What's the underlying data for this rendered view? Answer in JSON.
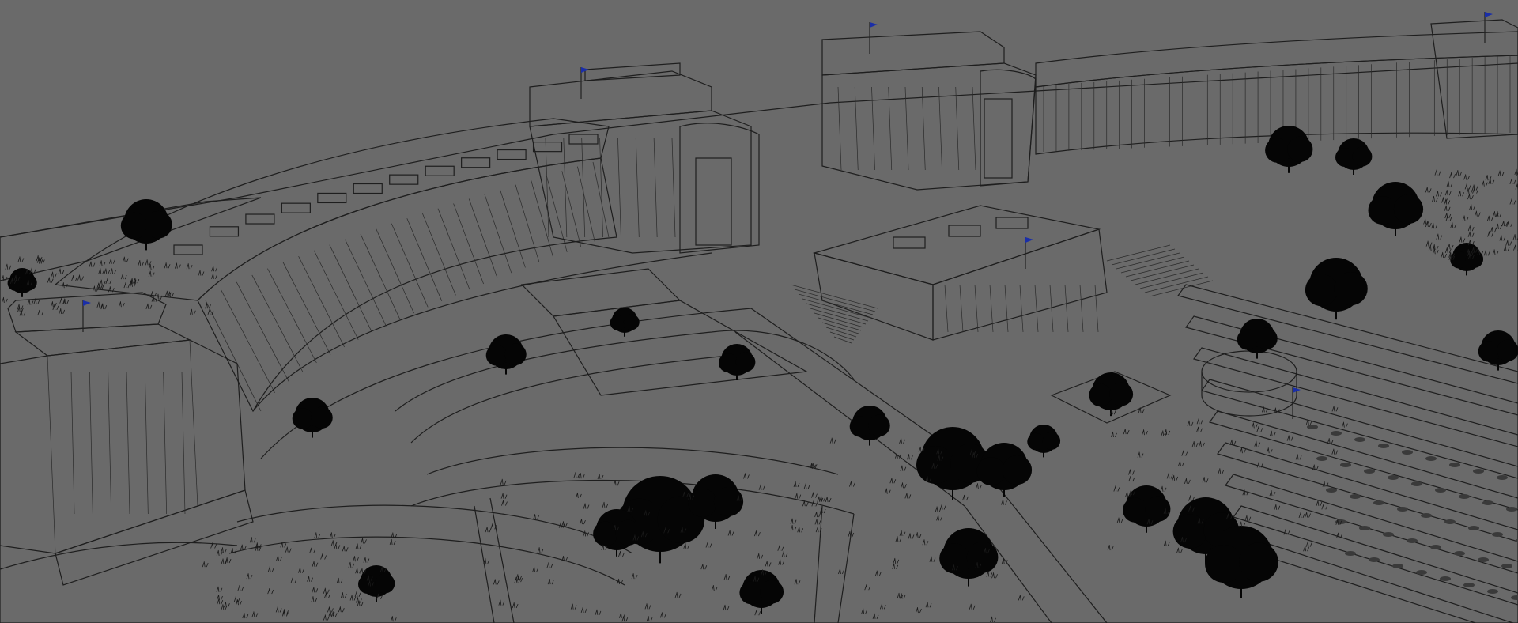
{
  "scene": {
    "kind": "3d-viewport-render",
    "style": "grey-shaded-with-wireframe",
    "subject": "curved-colonnade-palace-with-terraced-gardens",
    "colors": {
      "background": "#6a6a6a",
      "surface": "#c8c8c8",
      "surface_shadow": "#a9a9a9",
      "edge": "#1e1e1e",
      "tree": "#050505",
      "flag": "#1a2ea8"
    }
  }
}
